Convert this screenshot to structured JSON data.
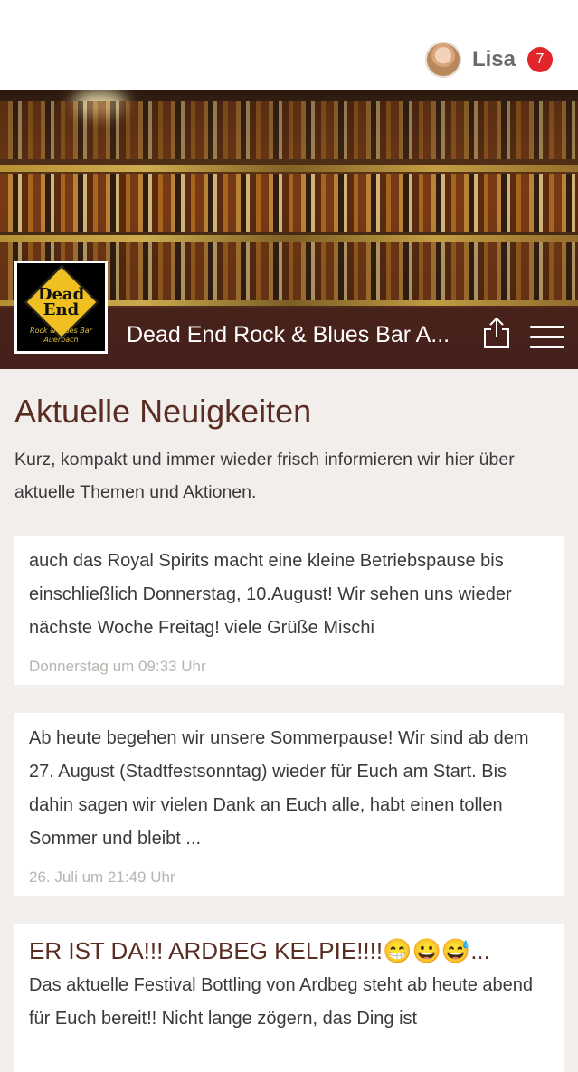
{
  "header": {
    "user_name": "Lisa",
    "notification_count": "7"
  },
  "bar": {
    "title": "Dead End Rock & Blues Bar A...",
    "logo_line1": "Dead",
    "logo_line2": "End",
    "logo_sub": "Rock & Blues Bar Auerbach"
  },
  "page": {
    "heading": "Aktuelle Neuigkeiten",
    "intro": "Kurz, kompakt und immer wieder frisch informieren wir hier über aktuelle Themen und Aktionen."
  },
  "posts": [
    {
      "text": "auch das Royal Spirits macht eine kleine Betriebspause bis einschließlich Donnerstag, 10.August! Wir sehen uns wieder nächste Woche Freitag! viele Grüße Mischi",
      "time": "Donnerstag um 09:33 Uhr"
    },
    {
      "text": "Ab heute begehen wir unsere Sommerpause! Wir sind ab dem 27. August (Stadtfestsonntag) wieder für Euch am Start. Bis dahin sagen wir vielen Dank an Euch alle, habt einen tollen Sommer und bleibt ...",
      "time": "26. Juli um 21:49 Uhr"
    },
    {
      "headline": "ER IST DA!!! ARDBEG KELPIE!!!!😁😀😅...",
      "text": "Das aktuelle Festival Bottling von Ardbeg steht ab heute abend für Euch bereit!! Nicht lange zögern, das Ding ist"
    }
  ]
}
